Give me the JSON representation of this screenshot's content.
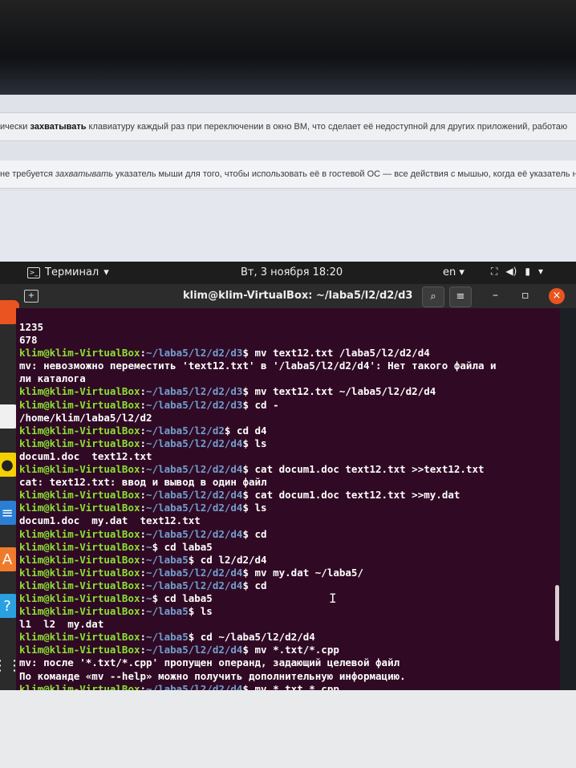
{
  "host": {
    "row1_prefix": "ически ",
    "row1_bold": "захватывать",
    "row1_rest": " клавиатуру каждый раз при переключении в окно ВМ, что сделает её недоступной для других приложений, работаю",
    "row2_prefix": "не требуется ",
    "row2_ital": "захватывать",
    "row2_rest": " указатель мыши для того, чтобы использовать её в гостевой ОС — все действия с мышью, когда её указатель нах"
  },
  "topbar": {
    "app_label": "Терминал",
    "clock": "Вт, 3 ноября  18:20",
    "lang": "en"
  },
  "titlebar": {
    "title": "klim@klim-VirtualBox: ~/laba5/l2/d2/d3"
  },
  "terminal": {
    "lines": [
      {
        "text": "1235"
      },
      {
        "text": "678"
      },
      {
        "user": "klim@klim-VirtualBox",
        "path": "~/laba5/l2/d2/d3",
        "cmd": "$ mv text12.txt /laba5/l2/d2/d4"
      },
      {
        "text": "mv: невозможно переместить 'text12.txt' в '/laba5/l2/d2/d4': Нет такого файла и"
      },
      {
        "text": "ли каталога"
      },
      {
        "user": "klim@klim-VirtualBox",
        "path": "~/laba5/l2/d2/d3",
        "cmd": "$ mv text12.txt ~/laba5/l2/d2/d4"
      },
      {
        "user": "klim@klim-VirtualBox",
        "path": "~/laba5/l2/d2/d3",
        "cmd": "$ cd -"
      },
      {
        "text": "/home/klim/laba5/l2/d2"
      },
      {
        "user": "klim@klim-VirtualBox",
        "path": "~/laba5/l2/d2",
        "cmd": "$ cd d4"
      },
      {
        "user": "klim@klim-VirtualBox",
        "path": "~/laba5/l2/d2/d4",
        "cmd": "$ ls"
      },
      {
        "text": "docum1.doc  text12.txt"
      },
      {
        "user": "klim@klim-VirtualBox",
        "path": "~/laba5/l2/d2/d4",
        "cmd": "$ cat docum1.doc text12.txt >>text12.txt"
      },
      {
        "text": "cat: text12.txt: ввод и вывод в один файл"
      },
      {
        "user": "klim@klim-VirtualBox",
        "path": "~/laba5/l2/d2/d4",
        "cmd": "$ cat docum1.doc text12.txt >>my.dat"
      },
      {
        "user": "klim@klim-VirtualBox",
        "path": "~/laba5/l2/d2/d4",
        "cmd": "$ ls"
      },
      {
        "text": "docum1.doc  my.dat  text12.txt"
      },
      {
        "user": "klim@klim-VirtualBox",
        "path": "~/laba5/l2/d2/d4",
        "cmd": "$ cd"
      },
      {
        "user": "klim@klim-VirtualBox",
        "path": "~",
        "cmd": "$ cd laba5"
      },
      {
        "user": "klim@klim-VirtualBox",
        "path": "~/laba5",
        "cmd": "$ cd l2/d2/d4"
      },
      {
        "user": "klim@klim-VirtualBox",
        "path": "~/laba5/l2/d2/d4",
        "cmd": "$ mv my.dat ~/laba5/"
      },
      {
        "user": "klim@klim-VirtualBox",
        "path": "~/laba5/l2/d2/d4",
        "cmd": "$ cd"
      },
      {
        "user": "klim@klim-VirtualBox",
        "path": "~",
        "cmd": "$ cd laba5"
      },
      {
        "user": "klim@klim-VirtualBox",
        "path": "~/laba5",
        "cmd": "$ ls"
      },
      {
        "text": "l1  l2  my.dat"
      },
      {
        "user": "klim@klim-VirtualBox",
        "path": "~/laba5",
        "cmd": "$ cd ~/laba5/l2/d2/d4"
      },
      {
        "user": "klim@klim-VirtualBox",
        "path": "~/laba5/l2/d2/d4",
        "cmd": "$ mv *.txt/*.cpp"
      },
      {
        "text": "mv: после '*.txt/*.cpp' пропущен операнд, задающий целевой файл"
      },
      {
        "text": "По команде «mv --help» можно получить дополнительную информацию."
      },
      {
        "user": "klim@klim-VirtualBox",
        "path": "~/laba5/l2/d2/d4",
        "cmd": "$ mv *.txt *.cpp"
      }
    ]
  },
  "colors": {
    "terminal_bg": "#300a24",
    "prompt_user": "#8ae234",
    "prompt_path": "#729fcf",
    "close_button": "#e95420"
  }
}
